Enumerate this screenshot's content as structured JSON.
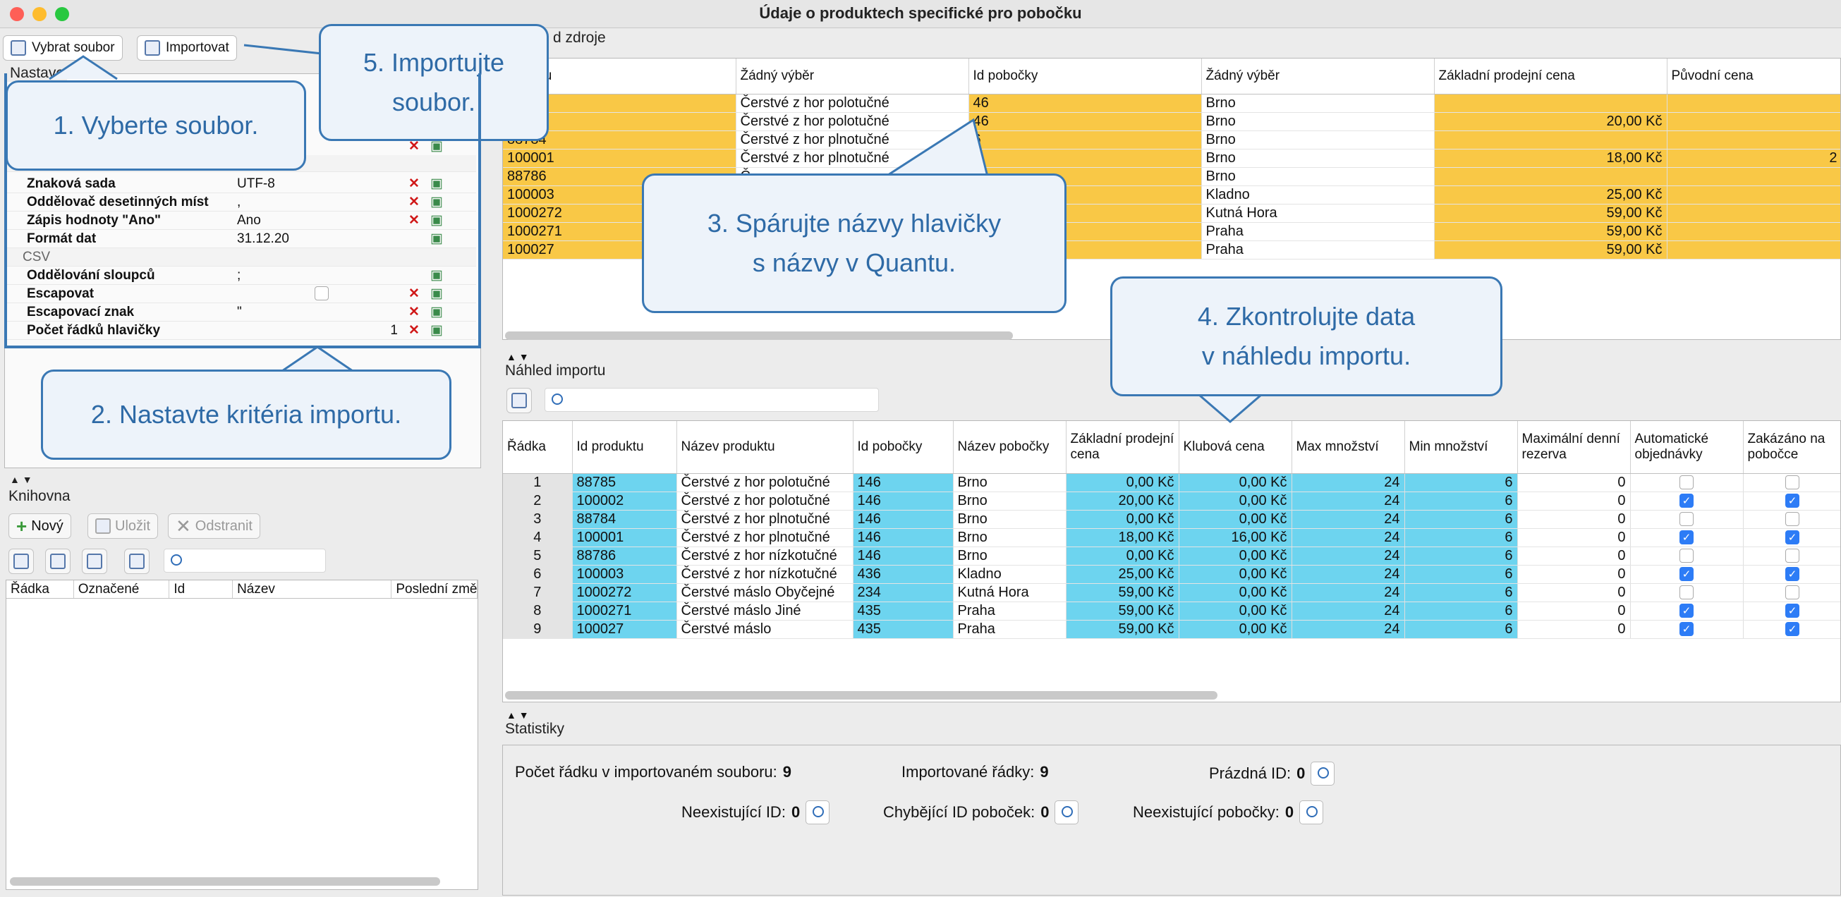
{
  "window": {
    "title": "Údaje o produktech specifické pro pobočku"
  },
  "toolbar": {
    "select_file": "Vybrat soubor",
    "import": "Importovat"
  },
  "settings": {
    "title": "Nastave",
    "rows": [
      {
        "key": "Znaková sada",
        "value": "UTF-8"
      },
      {
        "key": "Oddělovač desetinných míst",
        "value": ","
      },
      {
        "key": "Zápis hodnoty \"Ano\"",
        "value": "Ano"
      },
      {
        "key": "Formát dat",
        "value": "31.12.20"
      }
    ],
    "csv_section": "CSV",
    "csv_rows": [
      {
        "key": "Oddělování sloupců",
        "value": ";"
      },
      {
        "key": "Escapovat",
        "value": ""
      },
      {
        "key": "Escapovací znak",
        "value": "\""
      },
      {
        "key": "Počet řádků hlavičky",
        "value": "1"
      }
    ]
  },
  "library": {
    "title": "Knihovna",
    "new": "Nový",
    "save": "Uložit",
    "remove": "Odstranit",
    "columns": [
      "Řádka",
      "Označené",
      "Id",
      "Název",
      "Poslední změ"
    ]
  },
  "source": {
    "title": "d zdroje",
    "columns": [
      "roduktu",
      "Žádný výběr",
      "Id pobočky",
      "Žádný výběr",
      "Základní prodejní cena",
      "Původní cena"
    ],
    "rows": [
      [
        "",
        "Čerstvé z hor polotučné",
        "46",
        "Brno",
        "",
        ""
      ],
      [
        "2",
        "Čerstvé z hor polotučné",
        "46",
        "Brno",
        "20,00 Kč",
        ""
      ],
      [
        "88784",
        "Čerstvé z hor plnotučné",
        "6",
        "Brno",
        "",
        ""
      ],
      [
        "100001",
        "Čerstvé z hor plnotučné",
        "6",
        "Brno",
        "18,00 Kč",
        "2"
      ],
      [
        "88786",
        "Č",
        "",
        "Brno",
        "",
        ""
      ],
      [
        "100003",
        "",
        "",
        "Kladno",
        "25,00 Kč",
        ""
      ],
      [
        "1000272",
        "",
        "",
        "Kutná Hora",
        "59,00 Kč",
        ""
      ],
      [
        "1000271",
        "",
        "",
        "Praha",
        "59,00 Kč",
        ""
      ],
      [
        "100027",
        "",
        "",
        "Praha",
        "59,00 Kč",
        ""
      ]
    ]
  },
  "preview": {
    "title": "Náhled importu",
    "columns": [
      "Řádka",
      "Id produktu",
      "Název produktu",
      "Id pobočky",
      "Název pobočky",
      "Základní prodejní cena",
      "Klubová cena",
      "Max množství",
      "Min množství",
      "Maximální denní rezerva",
      "Automatické objednávky",
      "Zakázáno na pobočce"
    ],
    "rows": [
      {
        "n": "1",
        "id": "88785",
        "name": "Čerstvé z hor polotučné",
        "bid": "146",
        "bname": "Brno",
        "price": "0,00 Kč",
        "club": "0,00 Kč",
        "max": "24",
        "min": "6",
        "res": "0",
        "auto": false,
        "ban": false
      },
      {
        "n": "2",
        "id": "100002",
        "name": "Čerstvé z hor polotučné",
        "bid": "146",
        "bname": "Brno",
        "price": "20,00 Kč",
        "club": "0,00 Kč",
        "max": "24",
        "min": "6",
        "res": "0",
        "auto": true,
        "ban": true
      },
      {
        "n": "3",
        "id": "88784",
        "name": "Čerstvé z hor plnotučné",
        "bid": "146",
        "bname": "Brno",
        "price": "0,00 Kč",
        "club": "0,00 Kč",
        "max": "24",
        "min": "6",
        "res": "0",
        "auto": false,
        "ban": false
      },
      {
        "n": "4",
        "id": "100001",
        "name": "Čerstvé z hor plnotučné",
        "bid": "146",
        "bname": "Brno",
        "price": "18,00 Kč",
        "club": "16,00 Kč",
        "max": "24",
        "min": "6",
        "res": "0",
        "auto": true,
        "ban": true
      },
      {
        "n": "5",
        "id": "88786",
        "name": "Čerstvé z hor nízkotučné",
        "bid": "146",
        "bname": "Brno",
        "price": "0,00 Kč",
        "club": "0,00 Kč",
        "max": "24",
        "min": "6",
        "res": "0",
        "auto": false,
        "ban": false
      },
      {
        "n": "6",
        "id": "100003",
        "name": "Čerstvé z hor nízkotučné",
        "bid": "436",
        "bname": "Kladno",
        "price": "25,00 Kč",
        "club": "0,00 Kč",
        "max": "24",
        "min": "6",
        "res": "0",
        "auto": true,
        "ban": true
      },
      {
        "n": "7",
        "id": "1000272",
        "name": "Čerstvé máslo Obyčejné",
        "bid": "234",
        "bname": "Kutná Hora",
        "price": "59,00 Kč",
        "club": "0,00 Kč",
        "max": "24",
        "min": "6",
        "res": "0",
        "auto": false,
        "ban": false
      },
      {
        "n": "8",
        "id": "1000271",
        "name": "Čerstvé máslo Jiné",
        "bid": "435",
        "bname": "Praha",
        "price": "59,00 Kč",
        "club": "0,00 Kč",
        "max": "24",
        "min": "6",
        "res": "0",
        "auto": true,
        "ban": true
      },
      {
        "n": "9",
        "id": "100027",
        "name": "Čerstvé máslo",
        "bid": "435",
        "bname": "Praha",
        "price": "59,00 Kč",
        "club": "0,00 Kč",
        "max": "24",
        "min": "6",
        "res": "0",
        "auto": true,
        "ban": true
      }
    ]
  },
  "stats": {
    "title": "Statistiky",
    "rows_in_file_label": "Počet řádku v importovaném souboru:",
    "rows_in_file": "9",
    "imported_label": "Importované řádky:",
    "imported": "9",
    "empty_ids_label": "Prázdná ID:",
    "empty_ids": "0",
    "nonexist_ids_label": "Neexistující ID:",
    "nonexist_ids": "0",
    "missing_branch_ids_label": "Chybějící ID poboček:",
    "missing_branch_ids": "0",
    "nonexist_branches_label": "Neexistující pobočky:",
    "nonexist_branches": "0"
  },
  "callouts": {
    "c1": "1. Vyberte soubor.",
    "c2": "2. Nastavte kritéria importu.",
    "c3a": "3. Spárujte názvy hlavičky",
    "c3b": "s názvy v Quantu.",
    "c4a": "4. Zkontrolujte data",
    "c4b": "v náhledu importu.",
    "c5a": "5. Importujte",
    "c5b": "soubor."
  }
}
